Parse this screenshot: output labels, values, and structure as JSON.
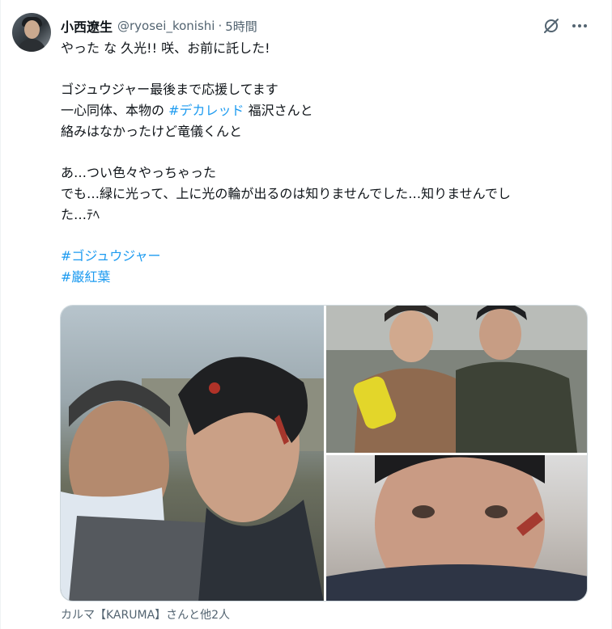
{
  "tweet": {
    "author_name": "小西遼生",
    "author_handle": "@ryosei_konishi",
    "separator": "·",
    "timestamp": "5時間",
    "grok_icon": "grok-icon",
    "more_icon": "more-icon",
    "lines": {
      "l1": "やった な 久光!! 咲、お前に託した!",
      "l2": "ゴジュウジャー最後まで応援してます",
      "l3_pre": "一心同体、本物の ",
      "l3_tag": "#デカレッド",
      "l3_post": " 福沢さんと",
      "l4": "絡みはなかったけど竜儀くんと",
      "l5": "あ…つい色々やっちゃった",
      "l6": "でも…緑に光って、上に光の輪が出るのは知りませんでした…知りませんでし",
      "l7": "た…ﾃﾍ"
    },
    "hashtags": [
      "#ゴジュウジャー",
      "#巌紅葉"
    ],
    "media_caption": "カルマ【KARUMA】さんと他2人"
  },
  "colors": {
    "link": "#1d9bf0",
    "secondary_text": "#536471",
    "primary_text": "#0f1419",
    "border": "#cfd9de"
  }
}
